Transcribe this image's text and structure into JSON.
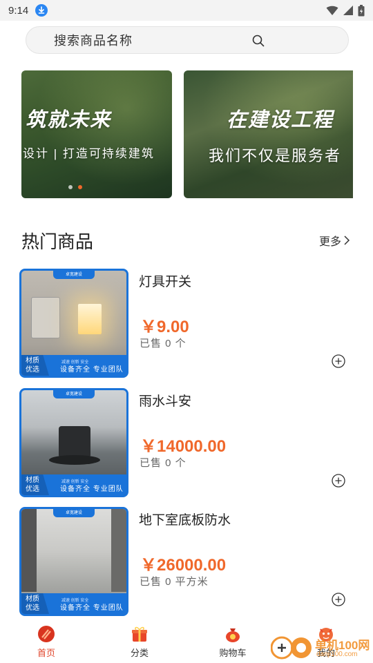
{
  "status_bar": {
    "time": "9:14"
  },
  "search": {
    "placeholder": "搜索商品名称"
  },
  "banners": [
    {
      "title": "筑就未来",
      "subtitle": "设计 | 打造可持续建筑"
    },
    {
      "title": "在建设工程",
      "subtitle": "我们不仅是服务者"
    }
  ],
  "section": {
    "title": "热门商品",
    "more_label": "更多"
  },
  "thumb_overlay": {
    "top_text": "卓宽建设",
    "badge_line1": "材质",
    "badge_line2": "优选",
    "tags": "减速 创新 安全",
    "slogan": "设备齐全 专业团队"
  },
  "products": [
    {
      "name": "灯具开关",
      "price": "￥9.00",
      "sold": "已售 0 个"
    },
    {
      "name": "雨水斗安",
      "price": "￥14000.00",
      "sold": "已售 0 个"
    },
    {
      "name": "地下室底板防水",
      "price": "￥26000.00",
      "sold": "已售 0 平方米"
    }
  ],
  "tabbar": {
    "items": [
      {
        "label": "首页",
        "icon": "home-icon",
        "active": true
      },
      {
        "label": "分类",
        "icon": "gift-box-icon",
        "active": false
      },
      {
        "label": "购物车",
        "icon": "money-bag-icon",
        "active": false
      },
      {
        "label": "我的",
        "icon": "mascot-icon",
        "active": false
      }
    ]
  },
  "watermark": {
    "text": "单机100网",
    "url": "danji100.com"
  },
  "colors": {
    "accent": "#f0682b",
    "brand_blue": "#1a73d9",
    "active_tab": "#e0452b"
  }
}
